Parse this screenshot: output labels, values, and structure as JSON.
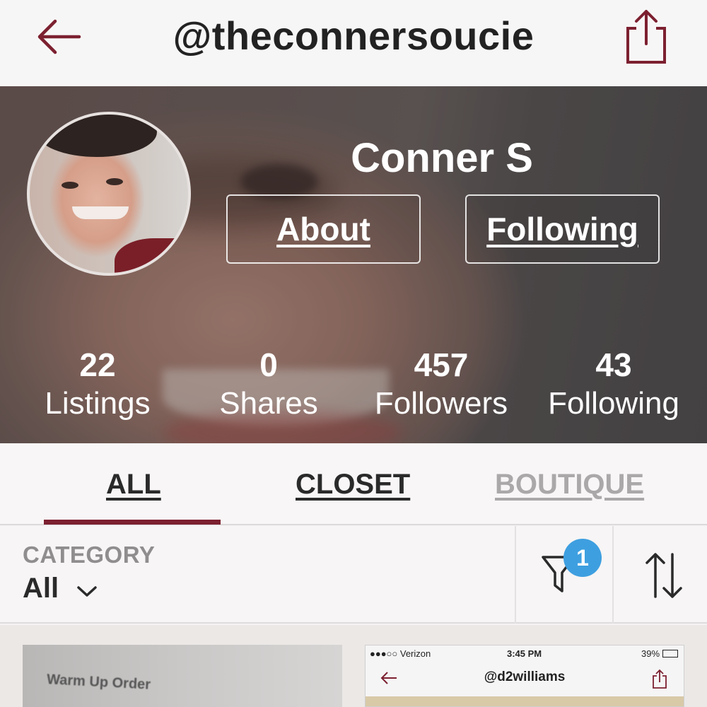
{
  "header": {
    "username": "@theconnersoucie",
    "back_icon": "back-arrow-icon",
    "share_icon": "share-icon",
    "accent": "#7c2030"
  },
  "profile": {
    "name": "Conner S",
    "about_label": "About",
    "following_button_label": "Following"
  },
  "stats": [
    {
      "value": "22",
      "label": "Listings"
    },
    {
      "value": "0",
      "label": "Shares"
    },
    {
      "value": "457",
      "label": "Followers"
    },
    {
      "value": "43",
      "label": "Following"
    }
  ],
  "tabs": {
    "all": "ALL",
    "closet": "CLOSET",
    "boutique": "BOUTIQUE",
    "active": "ALL"
  },
  "filter": {
    "category_label": "CATEGORY",
    "category_value": "All",
    "filter_badge": "1",
    "badge_color": "#3e9fe0"
  },
  "listings": [
    {
      "caption": "Warm Up Order"
    },
    {
      "status_carrier": "●●●○○ Verizon",
      "status_time": "3:45 PM",
      "status_battery": "39%",
      "title": "@d2williams"
    }
  ]
}
